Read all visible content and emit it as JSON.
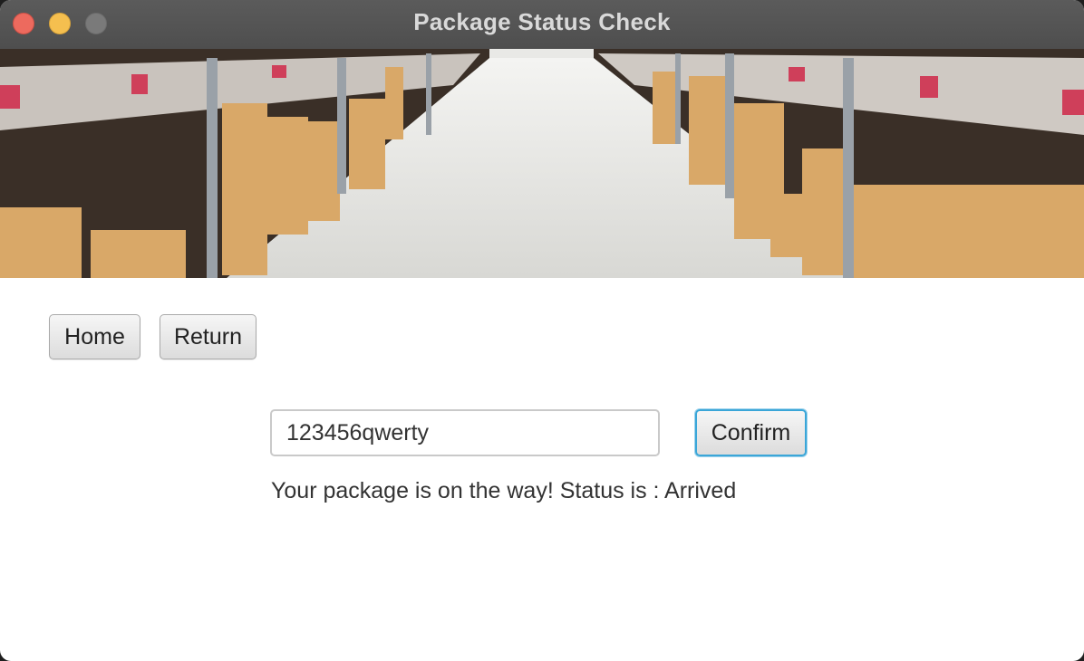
{
  "window": {
    "title": "Package Status Check"
  },
  "nav": {
    "home_label": "Home",
    "return_label": "Return"
  },
  "form": {
    "tracking_input_value": "123456qwerty",
    "confirm_label": "Confirm"
  },
  "result": {
    "status_message": "Your package is on the way! Status is : Arrived"
  },
  "colors": {
    "close": "#ed6a5e",
    "minimize": "#f5bf4f",
    "maximize": "#7a7a7a",
    "focus_ring": "#3aa6d8"
  }
}
